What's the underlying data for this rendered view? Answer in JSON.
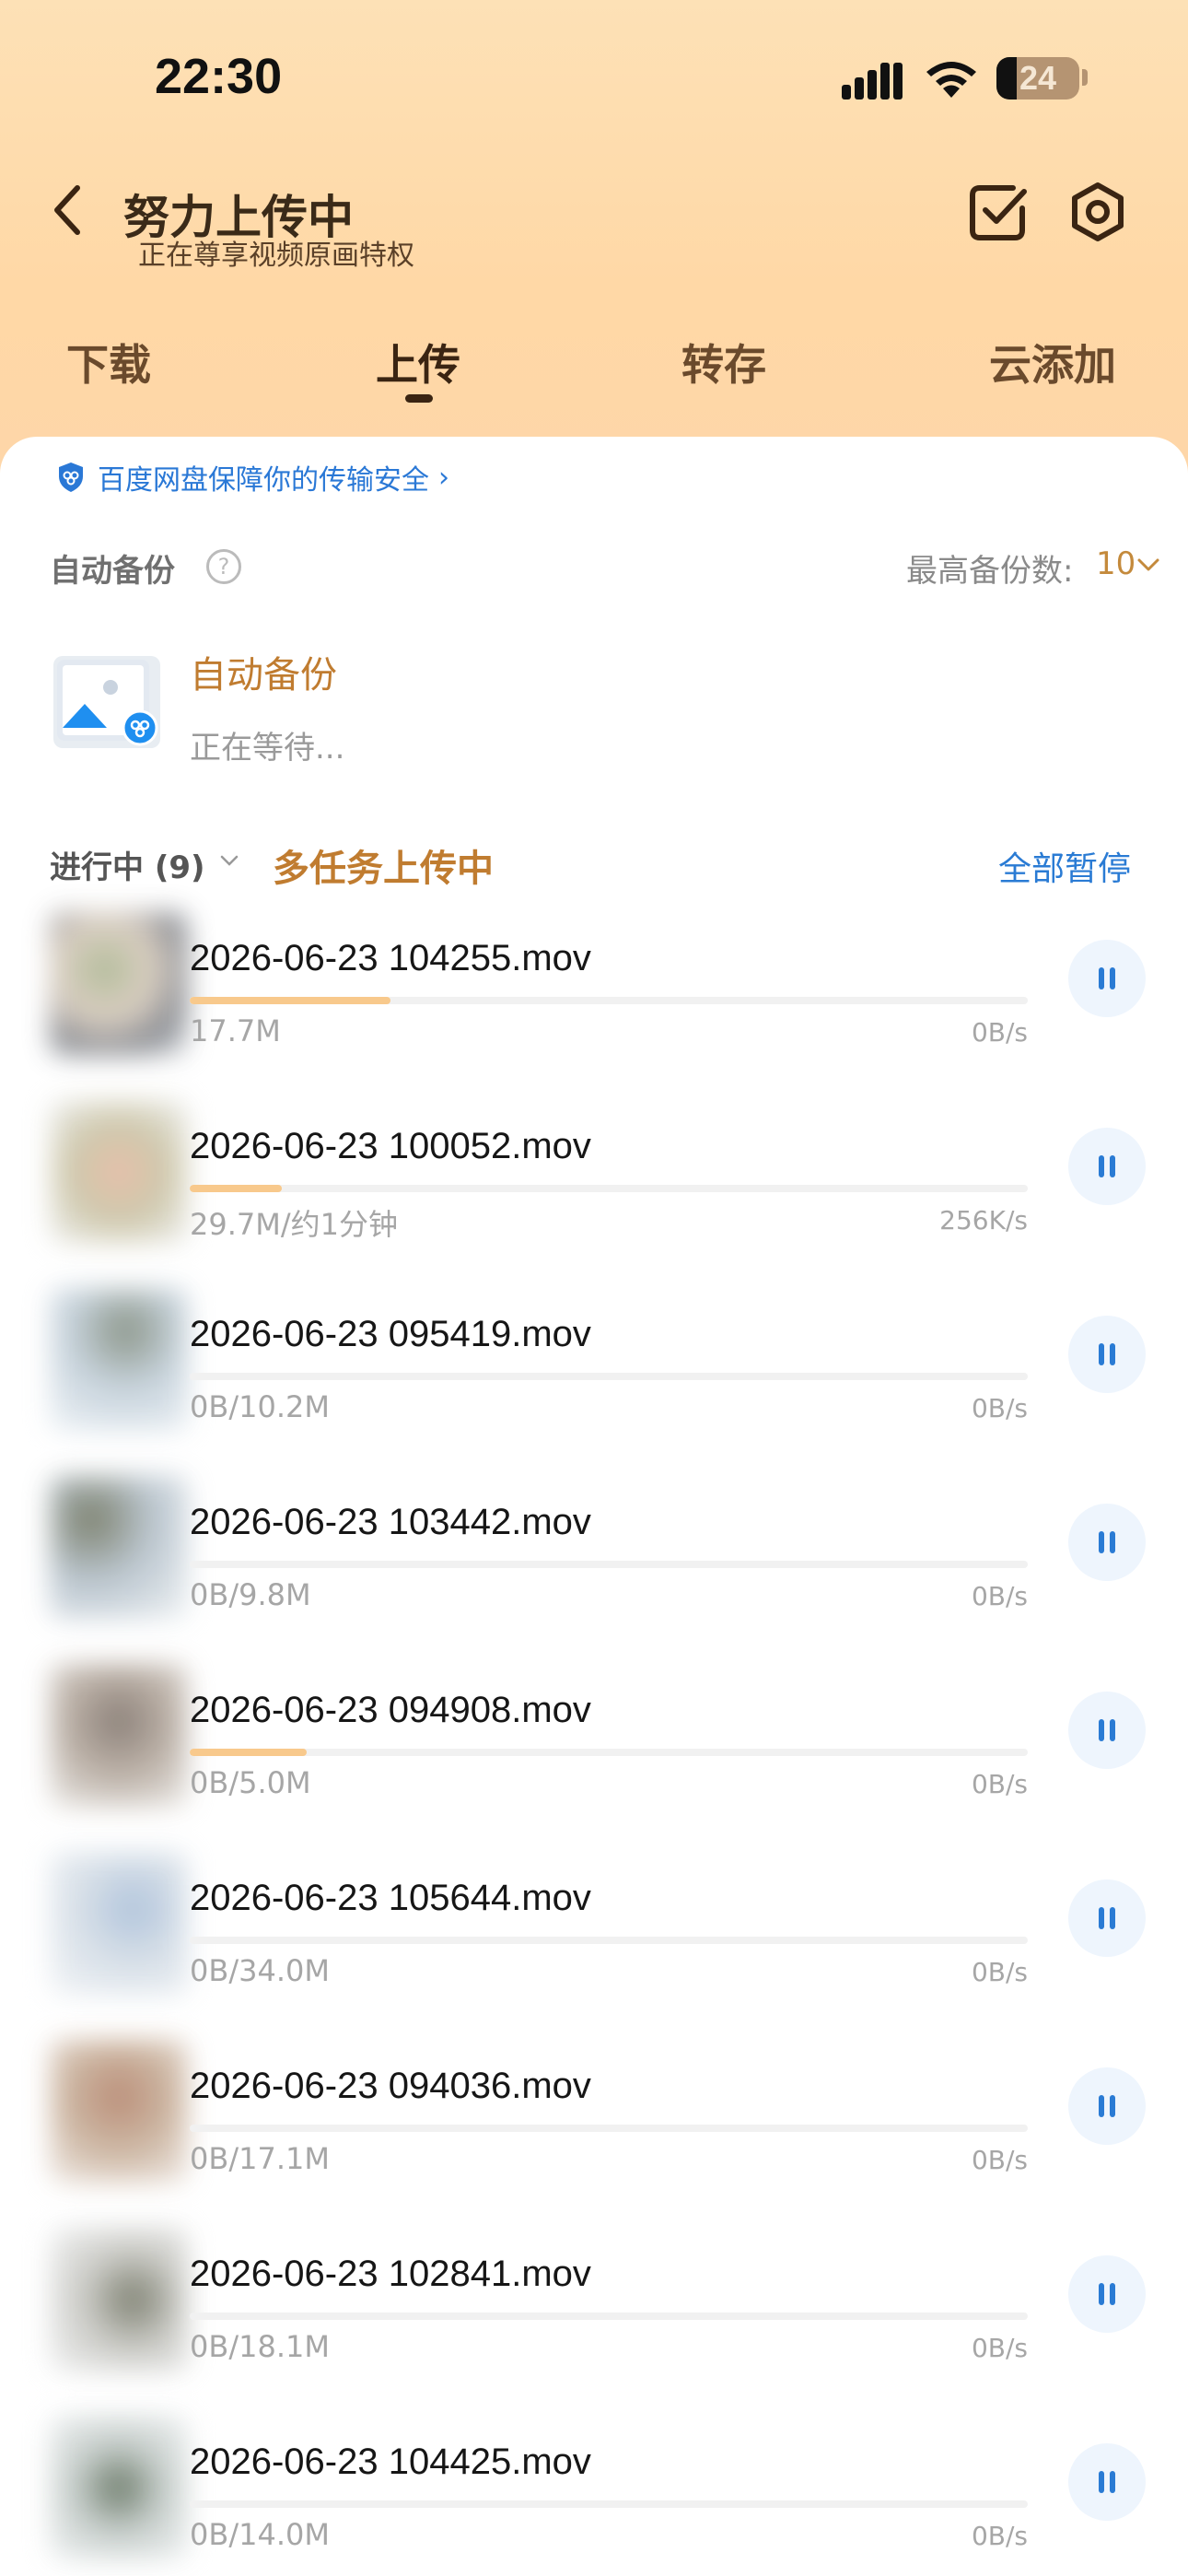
{
  "status_bar": {
    "time": "22:30",
    "battery": "24"
  },
  "header": {
    "title": "努力上传中",
    "subtitle": "正在尊享视频原画特权"
  },
  "tabs": [
    {
      "label": "下载"
    },
    {
      "label": "上传"
    },
    {
      "label": "转存"
    },
    {
      "label": "云添加"
    }
  ],
  "active_tab": "上传",
  "security": {
    "text": "百度网盘保障你的传输安全",
    "chevron": "›"
  },
  "auto_backup": {
    "section_label": "自动备份",
    "help_icon": "?",
    "max_label": "最高备份数:",
    "max_value": "10",
    "item_title": "自动备份",
    "item_status": "正在等待..."
  },
  "in_progress": {
    "label": "进行中 (9)",
    "multi_label": "多任务上传中",
    "pause_all": "全部暂停"
  },
  "colors": {
    "accent": "#c07c30",
    "link": "#2a7bd4",
    "progress": "#f8c98c",
    "header_bg": "#fed6a8"
  },
  "tasks": [
    {
      "name": "2026-06-23 104255.mov",
      "size": "17.7M",
      "speed": "0B/s",
      "progress": 0.24
    },
    {
      "name": "2026-06-23 100052.mov",
      "size": "29.7M/约1分钟",
      "speed": "256K/s",
      "progress": 0.11
    },
    {
      "name": "2026-06-23 095419.mov",
      "size": "0B/10.2M",
      "speed": "0B/s",
      "progress": 0.0
    },
    {
      "name": "2026-06-23 103442.mov",
      "size": "0B/9.8M",
      "speed": "0B/s",
      "progress": 0.0
    },
    {
      "name": "2026-06-23 094908.mov",
      "size": "0B/5.0M",
      "speed": "0B/s",
      "progress": 0.14
    },
    {
      "name": "2026-06-23 105644.mov",
      "size": "0B/34.0M",
      "speed": "0B/s",
      "progress": 0.0
    },
    {
      "name": "2026-06-23 094036.mov",
      "size": "0B/17.1M",
      "speed": "0B/s",
      "progress": 0.0
    },
    {
      "name": "2026-06-23 102841.mov",
      "size": "0B/18.1M",
      "speed": "0B/s",
      "progress": 0.0
    },
    {
      "name": "2026-06-23 104425.mov",
      "size": "0B/14.0M",
      "speed": "0B/s",
      "progress": 0.0
    }
  ]
}
